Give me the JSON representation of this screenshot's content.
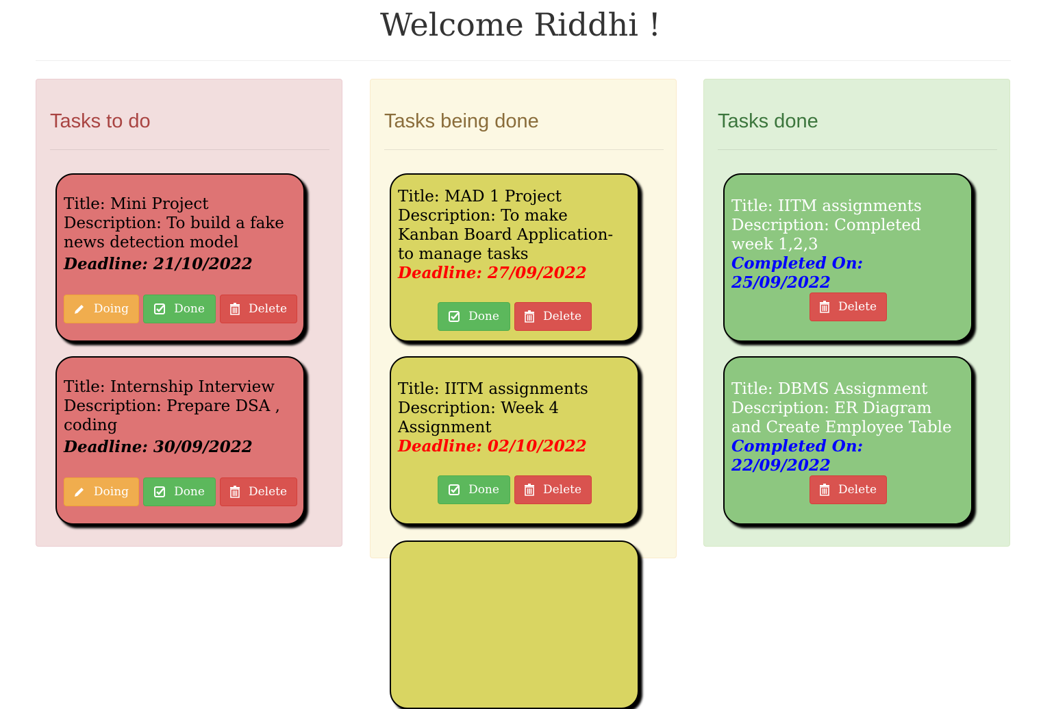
{
  "header": {
    "title": "Welcome Riddhi !"
  },
  "columns": {
    "todo": {
      "heading": "Tasks to do",
      "cards": [
        {
          "title": "Title: Mini Project",
          "description": "Description: To build a fake news detection model",
          "deadline": "Deadline: 21/10/2022"
        },
        {
          "title": "Title: Internship Interview",
          "description": "Description: Prepare DSA , coding",
          "deadline": "Deadline: 30/09/2022"
        }
      ]
    },
    "doing": {
      "heading": "Tasks being done",
      "cards": [
        {
          "title": "Title: MAD 1 Project",
          "description": "Description: To make Kanban Board Application- to manage tasks",
          "deadline": "Deadline: 27/09/2022"
        },
        {
          "title": "Title: IITM assignments",
          "description": "Description: Week 4 Assignment",
          "deadline": "Deadline: 02/10/2022"
        }
      ]
    },
    "done": {
      "heading": "Tasks done",
      "cards": [
        {
          "title": "Title: IITM assignments",
          "description": "Description: Completed week 1,2,3",
          "completed": "Completed On: 25/09/2022"
        },
        {
          "title": "Title: DBMS Assignment",
          "description": "Description: ER Diagram and Create Employee Table",
          "completed": "Completed On: 22/09/2022"
        }
      ]
    }
  },
  "buttons": {
    "doing": "Doing",
    "done": "Done",
    "delete": "Delete"
  },
  "icons": {
    "doing": "pencil-icon",
    "done": "check-square-icon",
    "delete": "trash-icon"
  },
  "colors": {
    "todo_card": "#de7474",
    "doing_card": "#d9d562",
    "done_card": "#8dc780",
    "doing_deadline": "#ff0000",
    "done_completed": "#0000ff"
  }
}
